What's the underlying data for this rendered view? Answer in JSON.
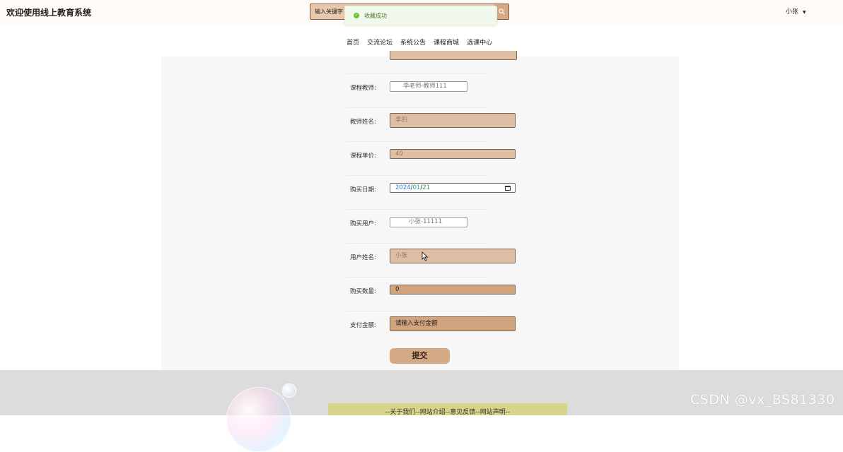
{
  "header": {
    "title": "欢迎使用线上教育系统",
    "search_placeholder": "输入关键字",
    "user_name": "小张"
  },
  "toast": {
    "message": "收藏成功"
  },
  "nav": {
    "items": [
      "首页",
      "交流论坛",
      "系统公告",
      "课程商城",
      "选课中心"
    ]
  },
  "form": {
    "teacher_label": "课程教师:",
    "teacher_value": "李老师-教师111",
    "teacher_name_label": "教师姓名:",
    "teacher_name_value": "李四",
    "price_label": "课程单价:",
    "price_value": "40",
    "date_label": "购买日期:",
    "date_year": "2024",
    "date_month": "01",
    "date_day": "21",
    "buyer_label": "购买用户:",
    "buyer_value": "小张-11111",
    "user_name_label": "用户姓名:",
    "user_name_value": "小张",
    "quantity_label": "购买数量:",
    "quantity_value": "0",
    "amount_label": "支付金额:",
    "amount_placeholder": "请输入支付金额",
    "submit_label": "提交"
  },
  "footer": {
    "links": "--关于我们--网站介绍--意见反馈--网站声明--"
  },
  "watermark": "CSDN @vx_BS81330",
  "colors": {
    "accent": "#d6a985",
    "field_bg": "#dfbfa4",
    "toast_bg": "#f0f9eb"
  }
}
